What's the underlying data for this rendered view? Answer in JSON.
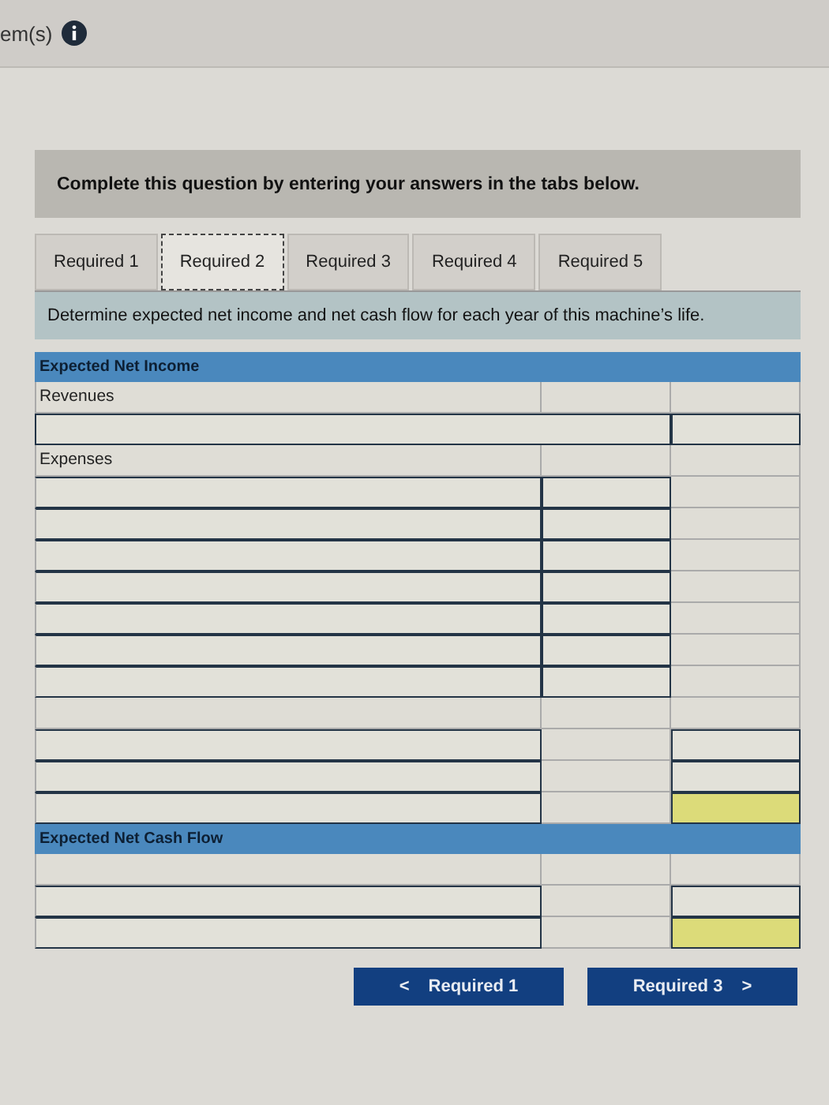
{
  "header": {
    "title": "em(s)"
  },
  "instruction": "Complete this question by entering your answers in the tabs below.",
  "tabs": [
    {
      "label": "Required 1",
      "selected": false
    },
    {
      "label": "Required 2",
      "selected": true
    },
    {
      "label": "Required 3",
      "selected": false
    },
    {
      "label": "Required 4",
      "selected": false
    },
    {
      "label": "Required 5",
      "selected": false
    }
  ],
  "prompt": "Determine expected net income and net cash flow for each year of this machine’s life.",
  "rows": [
    {
      "kind": "section",
      "label": "Expected Net Income"
    },
    {
      "kind": "label",
      "label": "Revenues"
    },
    {
      "kind": "wide-input"
    },
    {
      "kind": "label",
      "label": "Expenses"
    },
    {
      "kind": "expense-input"
    },
    {
      "kind": "expense-input"
    },
    {
      "kind": "expense-input"
    },
    {
      "kind": "expense-input"
    },
    {
      "kind": "expense-input"
    },
    {
      "kind": "expense-input"
    },
    {
      "kind": "expense-input"
    },
    {
      "kind": "blank"
    },
    {
      "kind": "total-input",
      "highlight": false
    },
    {
      "kind": "total-input",
      "highlight": false
    },
    {
      "kind": "total-input",
      "highlight": true
    },
    {
      "kind": "section",
      "label": "Expected Net Cash Flow"
    },
    {
      "kind": "blank"
    },
    {
      "kind": "total-input",
      "highlight": false
    },
    {
      "kind": "total-input",
      "highlight": true
    }
  ],
  "nav": {
    "prev": {
      "label": "Required 1",
      "symbol": "<"
    },
    "next": {
      "label": "Required 3",
      "symbol": ">"
    }
  }
}
